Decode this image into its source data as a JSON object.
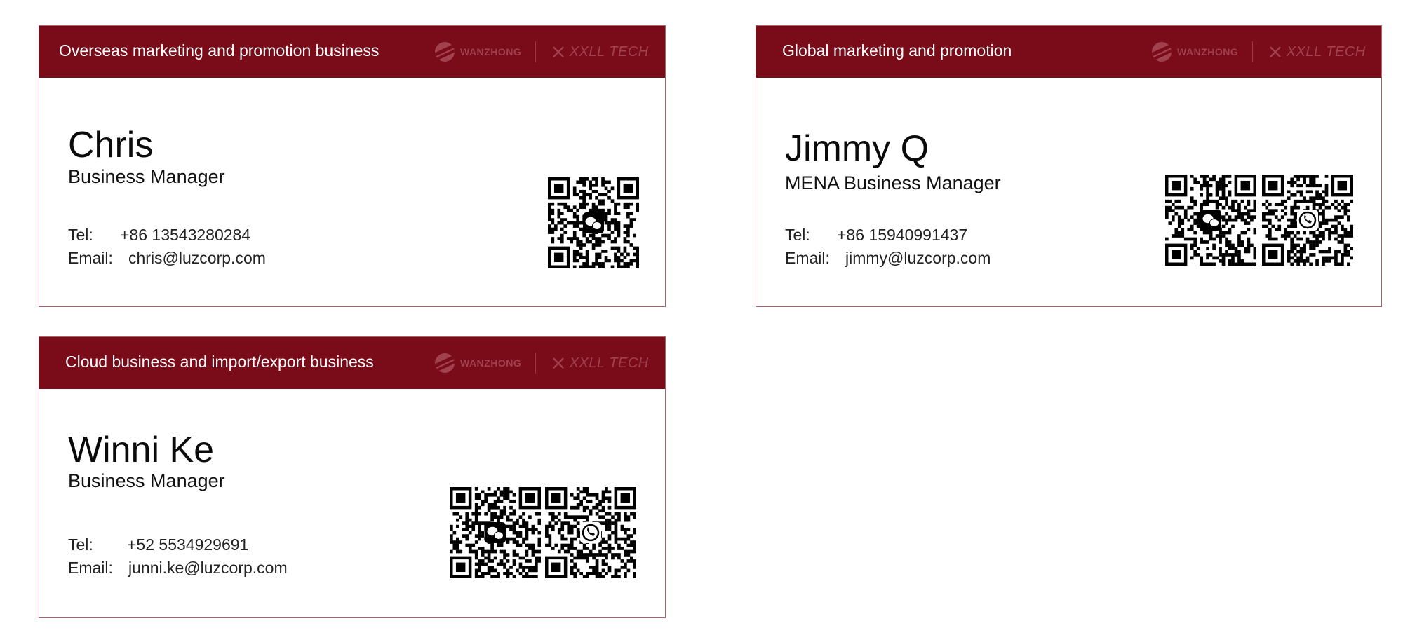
{
  "cards": [
    {
      "division": "Overseas marketing and promotion business",
      "logo_wanzhong": "WANZHONG",
      "logo_xxll": "XXLL TECH",
      "name": "Chris",
      "title": "Business Manager",
      "tel_label": "Tel:",
      "tel": "+86 13543280284",
      "email_label": "Email:",
      "email": "chris@luzcorp.com",
      "qr_codes": [
        "wechat-icon"
      ]
    },
    {
      "division": "Global marketing and promotion",
      "logo_wanzhong": "WANZHONG",
      "logo_xxll": "XXLL TECH",
      "name": "Jimmy Q",
      "title": "MENA Business Manager",
      "tel_label": "Tel:",
      "tel": "+86 15940991437",
      "email_label": "Email:",
      "email": "jimmy@luzcorp.com",
      "qr_codes": [
        "wechat-icon",
        "whatsapp-icon"
      ]
    },
    {
      "division": "Cloud business and import/export business",
      "logo_wanzhong": "WANZHONG",
      "logo_xxll": "XXLL TECH",
      "name": "Winni Ke",
      "title": "Business Manager",
      "tel_label": "Tel:",
      "tel": "+52 5534929691",
      "email_label": "Email:",
      "email": "junni.ke@luzcorp.com",
      "qr_codes": [
        "wechat-icon",
        "whatsapp-icon"
      ]
    }
  ],
  "colors": {
    "header_bg": "#7a0c1a",
    "border": "#b0606a",
    "logo_tint": "#a1414d"
  }
}
